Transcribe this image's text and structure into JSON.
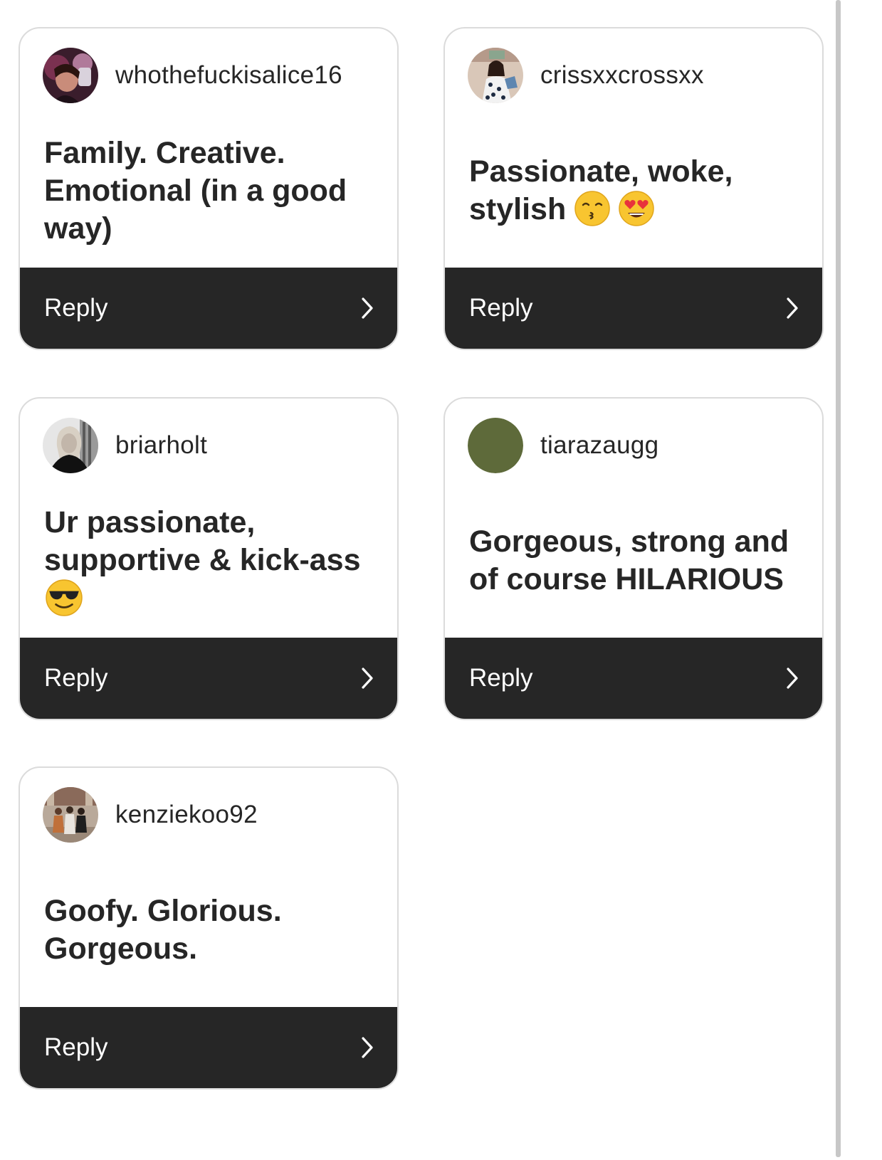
{
  "cards": [
    {
      "username": "whothefuckisalice16",
      "answer": "Family. Creative. Emotional (in a good way)",
      "reply_label": "Reply"
    },
    {
      "username": "crissxxcrossxx",
      "answer": "Passionate, woke, stylish",
      "emojis": [
        "kissing-face-icon",
        "heart-eyes-face-icon"
      ],
      "reply_label": "Reply"
    },
    {
      "username": "briarholt",
      "answer": "Ur passionate, supportive & kick-ass",
      "emojis": [
        "sunglasses-face-icon"
      ],
      "reply_label": "Reply"
    },
    {
      "username": "tiarazaugg",
      "answer": "Gorgeous, strong and of course HILARIOUS",
      "avatar_color": "#5e6a3a",
      "reply_label": "Reply"
    },
    {
      "username": "kenziekoo92",
      "answer": "Goofy. Glorious. Gorgeous.",
      "reply_label": "Reply"
    }
  ],
  "colors": {
    "reply_bar": "#262626",
    "card_border": "#dbdbdb",
    "text": "#262626"
  }
}
